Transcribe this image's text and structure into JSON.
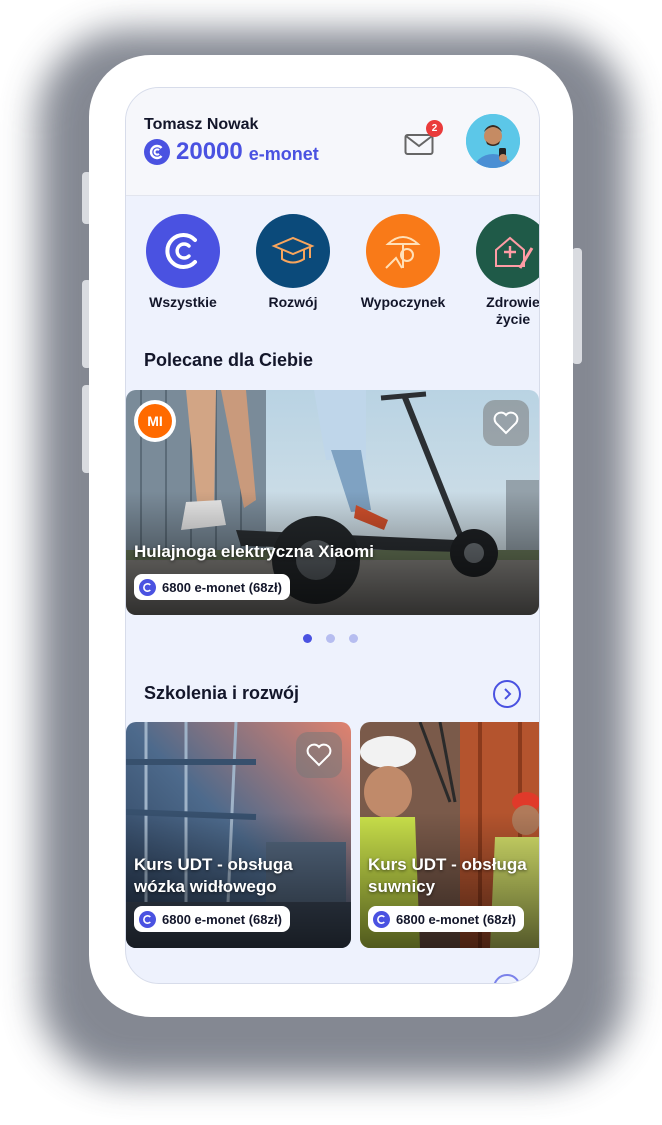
{
  "user": {
    "name": "Tomasz Nowak",
    "balance_amount": "20000",
    "balance_unit": "e-monet"
  },
  "notifications": {
    "count": "2"
  },
  "categories": [
    {
      "label": "Wszystkie",
      "color": "#4a52e1",
      "icon": "coin-icon"
    },
    {
      "label": "Rozwój",
      "color": "#0b4a7a",
      "icon": "graduation-cap-icon"
    },
    {
      "label": "Wypoczynek",
      "color": "#f97a18",
      "icon": "beach-icon"
    },
    {
      "label": "Zdrowie\nżycie",
      "color": "#1f5a48",
      "icon": "health-icon"
    }
  ],
  "featured": {
    "title": "Polecane dla Ciebie",
    "card": {
      "brand": "MI",
      "title": "Hulajnoga elektryczna Xiaomi",
      "price": "6800 e-monet (68zł)"
    },
    "pagination": {
      "active": 1,
      "total": 3
    }
  },
  "training": {
    "title": "Szkolenia i rozwój",
    "cards": [
      {
        "title": "Kurs UDT - obsługa wózka widłowego",
        "price": "6800 e-monet (68zł)"
      },
      {
        "title": "Kurs UDT - obsługa suwnicy",
        "price": "6800 e-monet (68zł)"
      }
    ]
  },
  "colors": {
    "accent": "#4a52e1",
    "badge": "#ea3b3b",
    "screen_bg": "#eef2fd"
  }
}
